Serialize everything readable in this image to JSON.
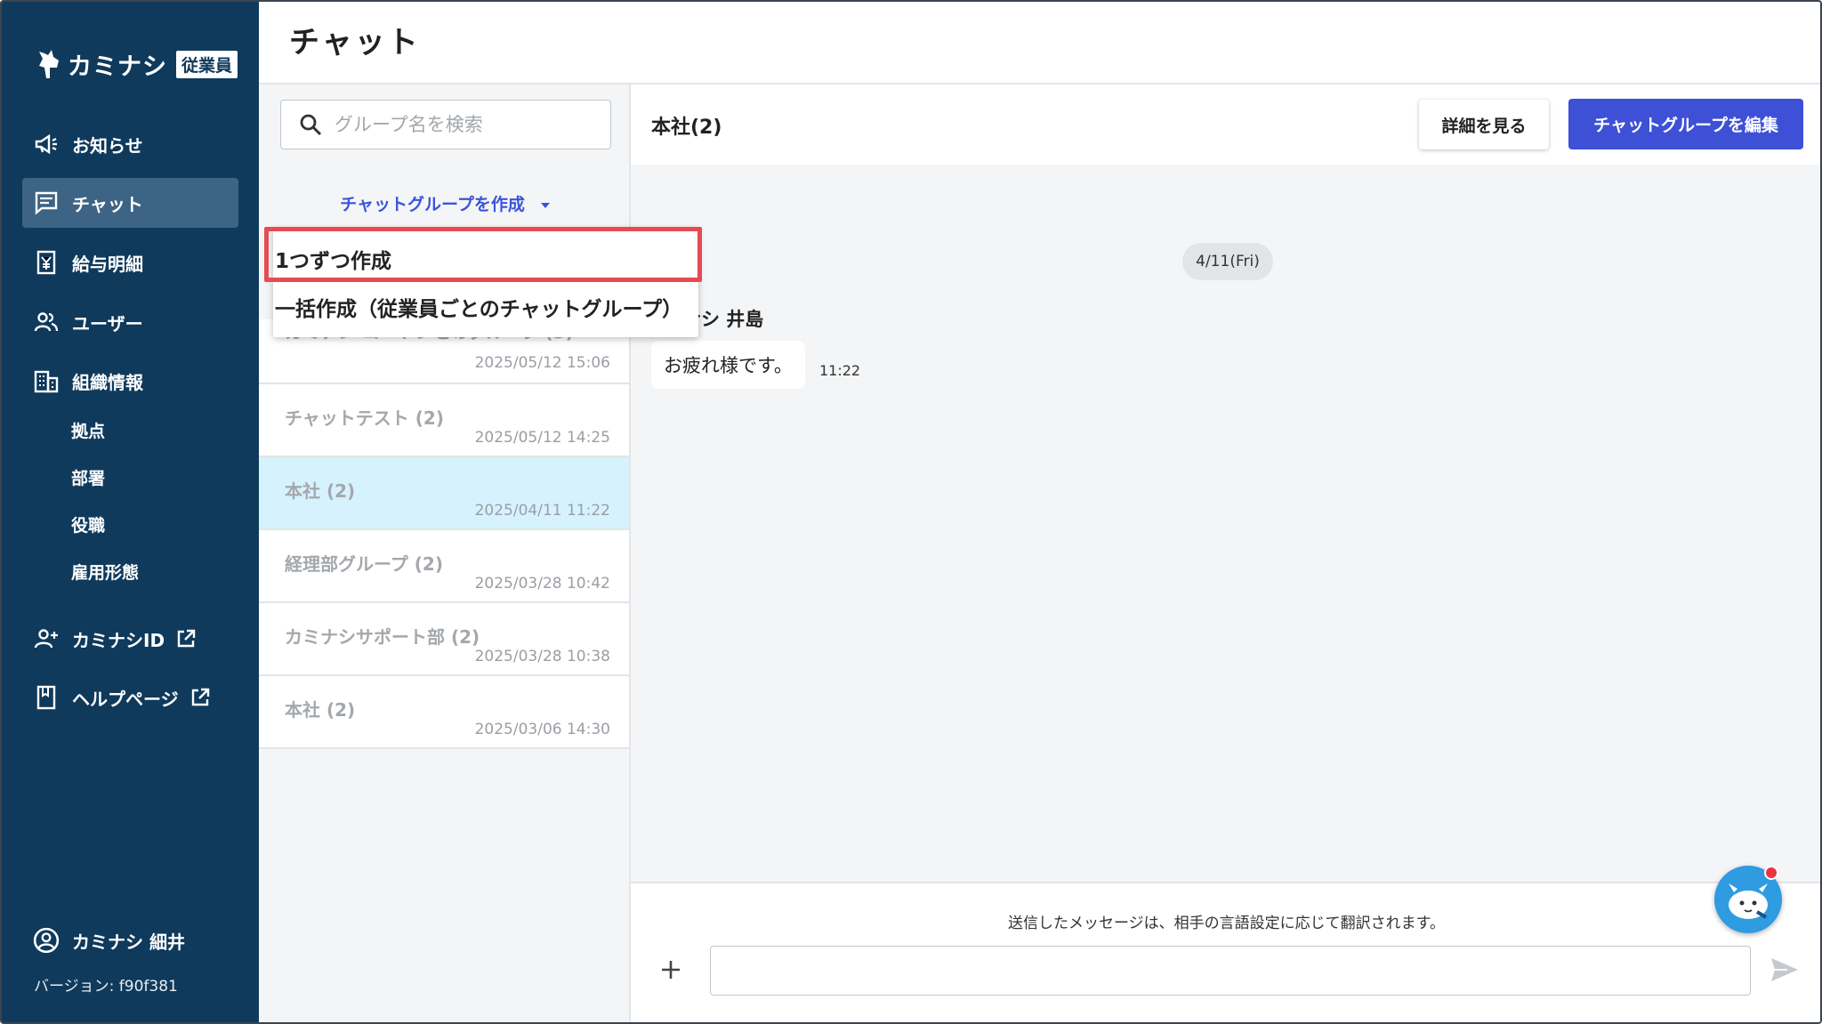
{
  "sidebar": {
    "logo_text": "カミナシ",
    "logo_badge": "従業員",
    "nav": [
      {
        "label": "お知らせ",
        "icon": "megaphone-icon"
      },
      {
        "label": "チャット",
        "icon": "chat-icon",
        "active": true
      },
      {
        "label": "給与明細",
        "icon": "payslip-icon"
      },
      {
        "label": "ユーザー",
        "icon": "users-icon"
      },
      {
        "label": "組織情報",
        "icon": "building-icon"
      }
    ],
    "sub_nav": [
      "拠点",
      "部署",
      "役職",
      "雇用形態"
    ],
    "links": [
      {
        "label": "カミナシID",
        "icon": "add-user-icon"
      },
      {
        "label": "ヘルプページ",
        "icon": "book-icon"
      }
    ],
    "user_name": "カミナシ 細井",
    "version": "バージョン: f90f381"
  },
  "header": {
    "title": "チャット"
  },
  "groups": {
    "search_placeholder": "グループ名を検索",
    "create_label": "チャットグループを作成",
    "dropdown": [
      "1つずつ作成",
      "一括作成（従業員ごとのチャットグループ）"
    ],
    "items": [
      {
        "name": "カミナシ コートンとのグループ (3)",
        "time": "2025/05/12 15:06"
      },
      {
        "name": "チャットテスト (2)",
        "time": "2025/05/12 14:25"
      },
      {
        "name": "本社 (2)",
        "time": "2025/04/11 11:22",
        "active": true
      },
      {
        "name": "経理部グループ (2)",
        "time": "2025/03/28 10:42"
      },
      {
        "name": "カミナシサポート部 (2)",
        "time": "2025/03/28 10:38"
      },
      {
        "name": "本社 (2)",
        "time": "2025/03/06 14:30"
      }
    ]
  },
  "chat": {
    "title": "本社(2)",
    "detail_button": "詳細を見る",
    "edit_button": "チャットグループを編集",
    "date": "4/11(Fri)",
    "sender": "ナシ 井島",
    "message": "お疲れ様です。",
    "message_time": "11:22",
    "translate_note": "送信したメッセージは、相手の言語設定に応じて翻訳されます。",
    "input_value": ""
  },
  "colors": {
    "sidebar": "#0f3a5c",
    "accent": "#3d50d6",
    "highlight": "#e44b52",
    "active_row": "#d6f2fd"
  }
}
